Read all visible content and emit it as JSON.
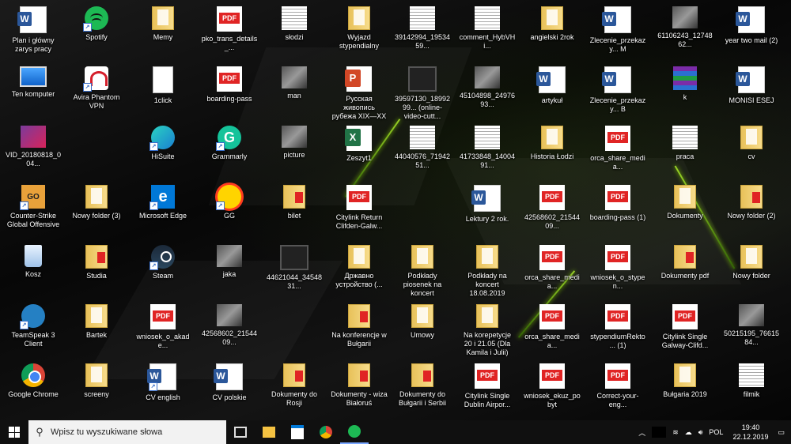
{
  "desktop": {
    "icons": [
      {
        "label": "Plan i główny zarys pracy",
        "type": "word"
      },
      {
        "label": "Spotify",
        "type": "spotify",
        "shortcut": true
      },
      {
        "label": "Memy",
        "type": "folder"
      },
      {
        "label": "pko_trans_details_...",
        "type": "pdf"
      },
      {
        "label": "słodzi",
        "type": "thumbdoc"
      },
      {
        "label": "Wyjazd stypendialny",
        "type": "folder"
      },
      {
        "label": "39142994_1953459...",
        "type": "thumbdoc"
      },
      {
        "label": "comment_HybVHi...",
        "type": "thumbdoc"
      },
      {
        "label": "angielski 2rok",
        "type": "folder"
      },
      {
        "label": "Zlecenie_przekazy... M",
        "type": "word"
      },
      {
        "label": "61106243_1274862...",
        "type": "thumb"
      },
      {
        "label": "year two mail (2)",
        "type": "word"
      },
      {
        "label": "Ten komputer",
        "type": "pc"
      },
      {
        "label": "Avira Phantom VPN",
        "type": "avira",
        "shortcut": true
      },
      {
        "label": "1click",
        "type": "file"
      },
      {
        "label": "boarding-pass",
        "type": "pdf"
      },
      {
        "label": "man",
        "type": "thumb"
      },
      {
        "label": "Русская живопись рубежа XIX—XX ...",
        "type": "ppt"
      },
      {
        "label": "39597130_1899299... (online-video-cutt...",
        "type": "video"
      },
      {
        "label": "45104898_2497693...",
        "type": "thumb"
      },
      {
        "label": "artykuł",
        "type": "word"
      },
      {
        "label": "Zlecenie_przekazy... B",
        "type": "word"
      },
      {
        "label": "k",
        "type": "winrar"
      },
      {
        "label": "MONISI ESEJ",
        "type": "word"
      },
      {
        "label": "VID_20180818_004...",
        "type": "photo"
      },
      {
        "label": "HiSuite",
        "type": "hisuite",
        "shortcut": true
      },
      {
        "label": "Grammarly",
        "type": "grammarly",
        "shortcut": true
      },
      {
        "label": "picture",
        "type": "thumb"
      },
      {
        "label": "Zeszyt1",
        "type": "excel"
      },
      {
        "label": "44040576_7194251...",
        "type": "thumbdoc"
      },
      {
        "label": "41733848_1400491...",
        "type": "thumbdoc"
      },
      {
        "label": "Historia Łodzi",
        "type": "folder"
      },
      {
        "label": "orca_share_media...",
        "type": "pdf"
      },
      {
        "label": "praca",
        "type": "thumbdoc"
      },
      {
        "label": "cv",
        "type": "folder"
      },
      {
        "label": "Counter-Strike Global Offensive",
        "type": "csgo",
        "shortcut": true
      },
      {
        "label": "Nowy folder (3)",
        "type": "folder"
      },
      {
        "label": "Microsoft Edge",
        "type": "edge",
        "shortcut": true
      },
      {
        "label": "GG",
        "type": "gg",
        "shortcut": true
      },
      {
        "label": "bilet",
        "type": "folderpdf"
      },
      {
        "label": "Citylink Return Clifden-Galw...",
        "type": "pdf"
      },
      {
        "label": "Lektury 2 rok.",
        "type": "word"
      },
      {
        "label": "42568602_2154409...",
        "type": "pdf"
      },
      {
        "label": "boarding-pass (1)",
        "type": "pdf"
      },
      {
        "label": "Dokumenty",
        "type": "folder"
      },
      {
        "label": "Nowy folder (2)",
        "type": "folderpdf"
      },
      {
        "label": "Kosz",
        "type": "bin"
      },
      {
        "label": "Studia",
        "type": "folderpdf"
      },
      {
        "label": "Steam",
        "type": "steam",
        "shortcut": true
      },
      {
        "label": "jaka",
        "type": "thumb"
      },
      {
        "label": "44621044_3454831...",
        "type": "video"
      },
      {
        "label": "Државно устройство (...",
        "type": "folder"
      },
      {
        "label": "Podkłady piosenek na koncert",
        "type": "folder"
      },
      {
        "label": "Podkłady na koncert 18.08.2019",
        "type": "folder"
      },
      {
        "label": "orca_share_media...",
        "type": "pdf"
      },
      {
        "label": "wniosek_o_stypen...",
        "type": "pdf"
      },
      {
        "label": "Dokumenty pdf",
        "type": "folderpdf"
      },
      {
        "label": "Nowy folder",
        "type": "folder"
      },
      {
        "label": "TeamSpeak 3 Client",
        "type": "teamspeak",
        "shortcut": true
      },
      {
        "label": "Bartek",
        "type": "folder"
      },
      {
        "label": "wniosek_o_akade...",
        "type": "pdf"
      },
      {
        "label": "42568602_2154409...",
        "type": "thumb"
      },
      {
        "label": "Na konferencje w Bułgarii",
        "type": "folderpdf"
      },
      {
        "label": "Umowy",
        "type": "folder"
      },
      {
        "label": "Na korepetycje 20 i 21.05 (Dla Kamila i Julii)",
        "type": "folder"
      },
      {
        "label": "orca_share_media...",
        "type": "pdf"
      },
      {
        "label": "stypendiumRekto... (1)",
        "type": "pdf"
      },
      {
        "label": "Citylink Single Galway-Clifd...",
        "type": "pdf"
      },
      {
        "label": "50215195_7661584...",
        "type": "thumb"
      },
      {
        "label": "Google Chrome",
        "type": "chrome"
      },
      {
        "label": "screeny",
        "type": "folder"
      },
      {
        "label": "CV english",
        "type": "word",
        "shortcut": true
      },
      {
        "label": "CV polskie",
        "type": "word"
      },
      {
        "label": "Dokumenty do Rosji",
        "type": "folderpdf"
      },
      {
        "label": "Dokumenty - wiza Białoruś",
        "type": "folderpdf"
      },
      {
        "label": "Dokumenty do Bułgarii i Serbii",
        "type": "folderpdf"
      },
      {
        "label": "Citylink Single Dublin Airpor...",
        "type": "pdf"
      },
      {
        "label": "wniosek_ekuz_pobyt",
        "type": "pdf"
      },
      {
        "label": "Correct-your-eng...",
        "type": "pdf"
      },
      {
        "label": "Bułgaria 2019",
        "type": "folder"
      },
      {
        "label": "filmik",
        "type": "thumbdoc"
      }
    ]
  },
  "taskbar": {
    "search_placeholder": "Wpisz tu wyszukiwane słowa",
    "apps": [
      "task-view",
      "file-explorer",
      "microsoft-store",
      "google-chrome",
      "spotify"
    ],
    "tray": {
      "language": "POL",
      "time": "19:40",
      "date": "22.12.2019"
    }
  },
  "colors": {
    "taskbar": "#101010",
    "search_bg": "#f2f2f2",
    "accent_glow": "#a6ff00"
  }
}
